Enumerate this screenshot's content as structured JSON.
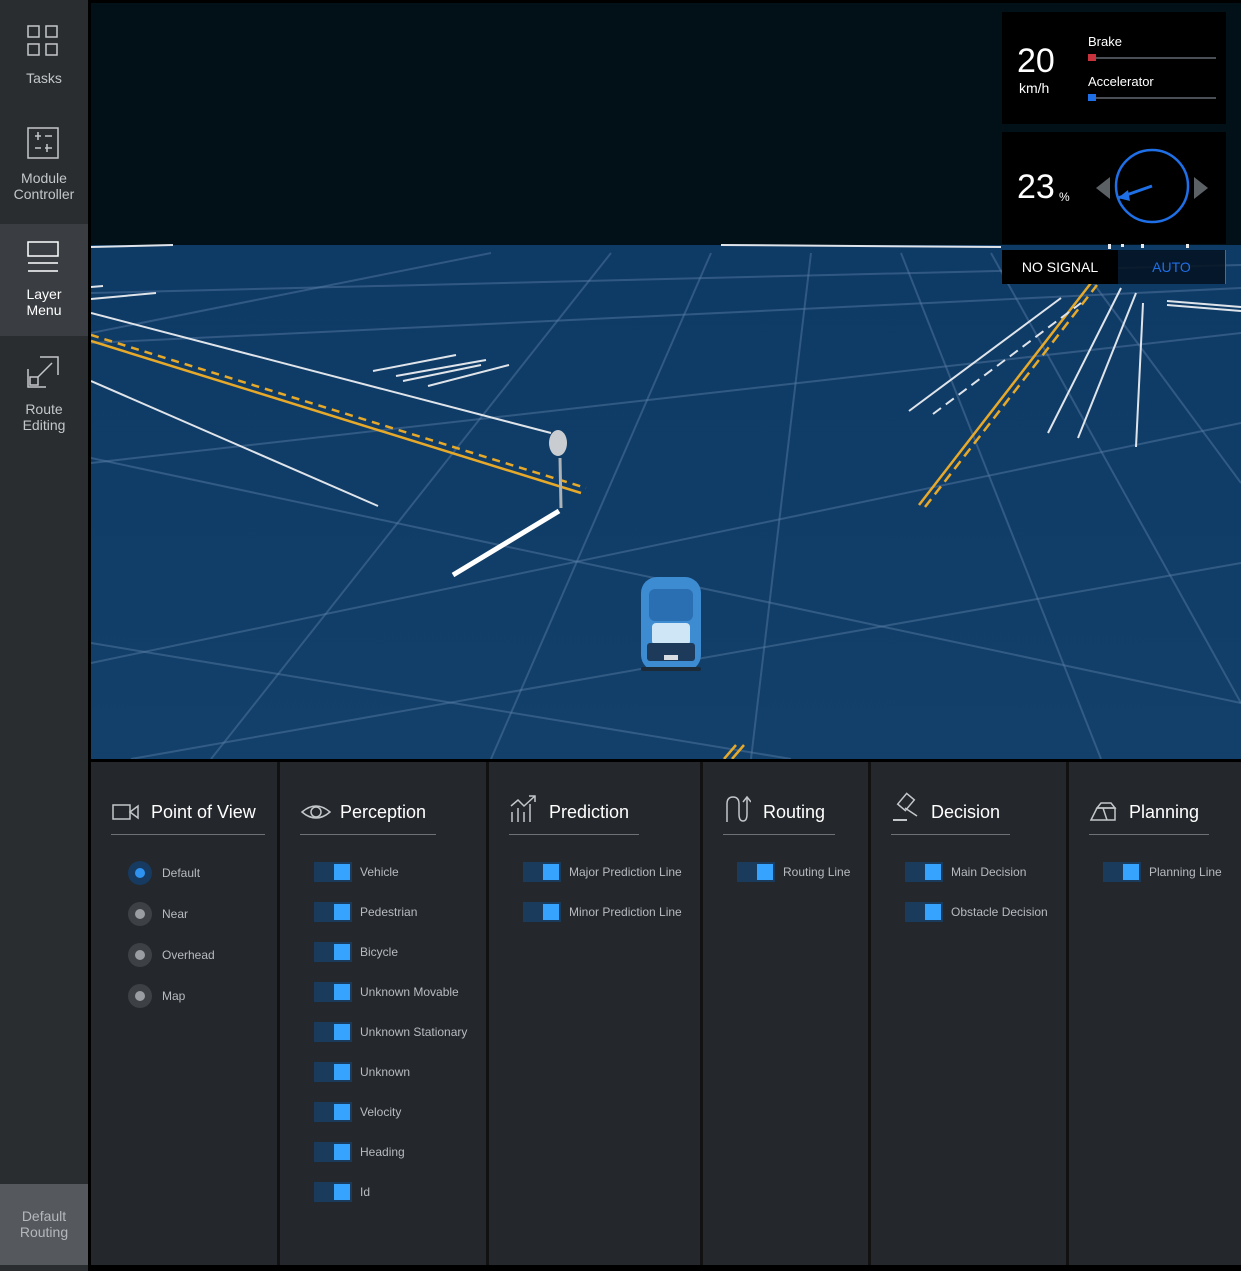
{
  "sidebar": {
    "items": [
      {
        "label": "Tasks",
        "icon": "grid-icon",
        "active": false
      },
      {
        "label": "Module Controller",
        "line1": "Module",
        "line2": "Controller",
        "icon": "sliders-icon",
        "active": false
      },
      {
        "label": "Layer Menu",
        "line1": "Layer",
        "line2": "Menu",
        "icon": "layers-icon",
        "active": true
      },
      {
        "label": "Route Editing",
        "line1": "Route",
        "line2": "Editing",
        "icon": "route-edit-icon",
        "active": false
      }
    ],
    "default_routing": {
      "line1": "Default",
      "line2": "Routing"
    }
  },
  "dashboard": {
    "speed": "20",
    "speed_unit": "km/h",
    "brake_label": "Brake",
    "brake_level": 0.06,
    "accelerator_label": "Accelerator",
    "accelerator_level": 0.06,
    "steering": "23",
    "steering_unit": "%",
    "signal": "NO SIGNAL",
    "mode": "AUTO",
    "colors": {
      "brake": "#c8323c",
      "accelerator": "#1f6fe6",
      "wheel": "#1f6fe6"
    }
  },
  "layer_menu": {
    "point_of_view": {
      "title": "Point of View",
      "icon": "camera-icon",
      "options": [
        {
          "label": "Default",
          "selected": true
        },
        {
          "label": "Near",
          "selected": false
        },
        {
          "label": "Overhead",
          "selected": false
        },
        {
          "label": "Map",
          "selected": false
        }
      ]
    },
    "perception": {
      "title": "Perception",
      "icon": "eye-icon",
      "options": [
        "Vehicle",
        "Pedestrian",
        "Bicycle",
        "Unknown Movable",
        "Unknown Stationary",
        "Unknown",
        "Velocity",
        "Heading",
        "Id"
      ]
    },
    "prediction": {
      "title": "Prediction",
      "icon": "trend-chart-icon",
      "options": [
        "Major Prediction Line",
        "Minor Prediction Line"
      ]
    },
    "routing": {
      "title": "Routing",
      "icon": "u-turn-icon",
      "options": [
        "Routing Line"
      ]
    },
    "decision": {
      "title": "Decision",
      "icon": "gavel-icon",
      "options": [
        "Main Decision",
        "Obstacle Decision"
      ]
    },
    "planning": {
      "title": "Planning",
      "icon": "planning-icon",
      "options": [
        "Planning Line"
      ]
    }
  }
}
